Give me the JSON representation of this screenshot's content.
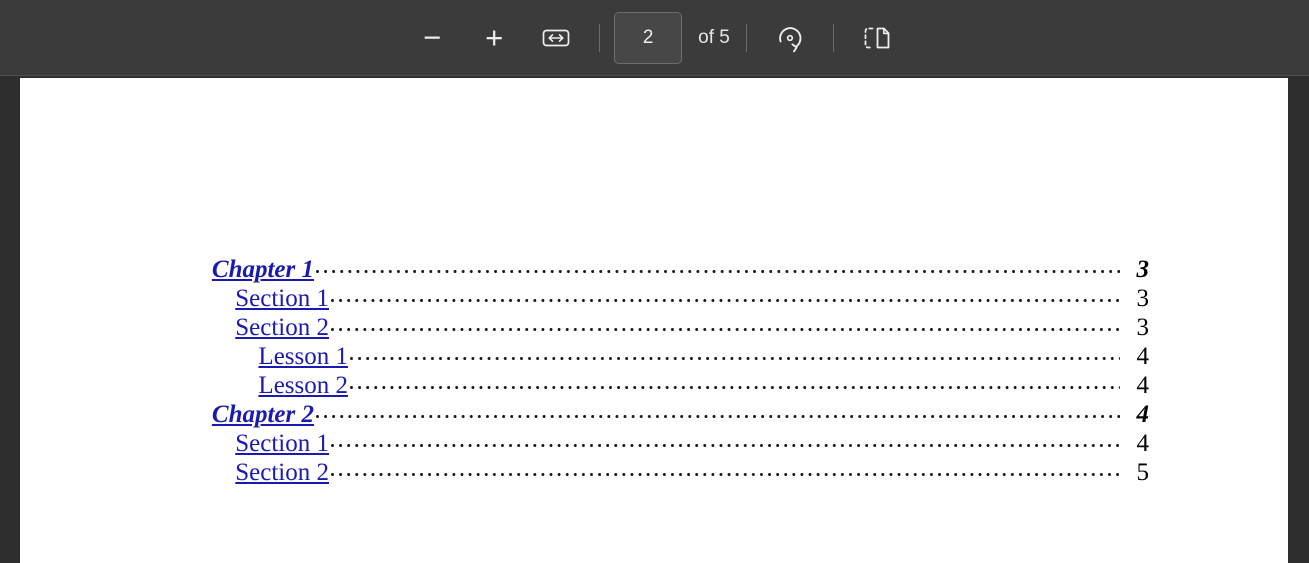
{
  "toolbar": {
    "zoom_out_label": "−",
    "zoom_out_name": "Zoom out",
    "zoom_in_label": "+",
    "zoom_in_name": "Zoom in",
    "fit_width_name": "Fit to width",
    "page_number_value": "2",
    "page_number_placeholder": "2",
    "page_total_label": "of 5",
    "rotate_name": "Rotate",
    "page_view_name": "Page view",
    "separator": "|",
    "colors": {
      "toolbar_bg": "#3b3b3b",
      "toolbar_border": "#4e4e4e",
      "icon": "#ededed",
      "input_bg": "#474747",
      "input_border": "#6e6e6e",
      "separator": "#6b6b6b",
      "viewer_bg": "#2e2e2e"
    }
  },
  "document": {
    "page_bg": "#ffffff",
    "link_color": "#1a1ab0",
    "page_number_color": "#000000",
    "toc": {
      "entries": [
        {
          "label": "Chapter 1",
          "page": "3",
          "level": 0
        },
        {
          "label": "Section 1",
          "page": "3",
          "level": 1
        },
        {
          "label": "Section 2",
          "page": "3",
          "level": 1
        },
        {
          "label": "Lesson 1",
          "page": "4",
          "level": 2
        },
        {
          "label": "Lesson 2",
          "page": "4",
          "level": 2
        },
        {
          "label": "Chapter 2",
          "page": "4",
          "level": 0
        },
        {
          "label": "Section 1",
          "page": "4",
          "level": 1
        },
        {
          "label": "Section 2",
          "page": "5",
          "level": 1
        }
      ]
    }
  }
}
